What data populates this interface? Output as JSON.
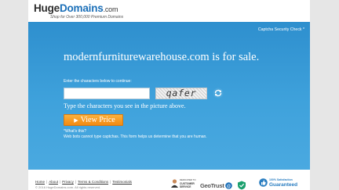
{
  "header": {
    "logo_huge": "Huge",
    "logo_domains": "Domains",
    "logo_com": ".com",
    "tagline": "Shop for Over 300,000 Premium Domains"
  },
  "hero": {
    "captcha_check_link": "Captcha Security Check",
    "domain_title": "modernfurniturewarehouse.com is for sale.",
    "enter_label": "Enter the characters below to continue:",
    "captcha_input_value": "",
    "captcha_image_text": "qafer",
    "type_instruction": "Type the characters you see in the picture above.",
    "view_price_label": "View Price",
    "whats_this": "*What's this?",
    "explain": "Web bots cannot type captchas. This form helps us determine that you are human."
  },
  "footer": {
    "links": [
      "Home",
      "About",
      "Privacy",
      "Terms & Conditions",
      "Testimonials"
    ],
    "copyright": "© 2016 HugeDomains.com. All rights reserved.",
    "badges": {
      "customer_service_line1": "DEDICATED TO",
      "customer_service_line2": "CUSTOMER",
      "customer_service_line3": "SERVICE",
      "geotrust": "GeoTrust",
      "satisfaction_line1": "100% Satisfaction",
      "satisfaction_line2": "Guaranteed"
    }
  },
  "colors": {
    "hero_blue": "#3fa2dc",
    "button_orange": "#f28a12",
    "logo_blue": "#1b6fb8"
  }
}
